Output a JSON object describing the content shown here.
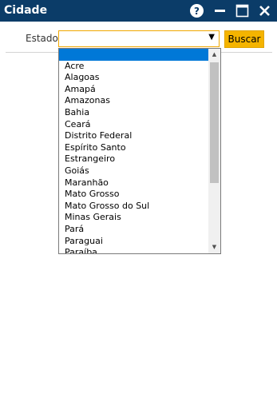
{
  "window": {
    "title": "Cidade",
    "help_icon": "help-icon",
    "minimize_icon": "minimize-icon",
    "maximize_icon": "maximize-icon",
    "close_icon": "close-icon"
  },
  "form": {
    "estado_label": "Estado:",
    "estado_value": "",
    "dropdown_arrow": "▼",
    "search_button_label": "Buscar"
  },
  "dropdown": {
    "options": [
      "",
      "Acre",
      "Alagoas",
      "Amapá",
      "Amazonas",
      "Bahia",
      "Ceará",
      "Distrito Federal",
      "Espírito Santo",
      "Estrangeiro",
      "Goiás",
      "Maranhão",
      "Mato Grosso",
      "Mato Grosso do Sul",
      "Minas Gerais",
      "Pará",
      "Paraguai",
      "Paraíba"
    ],
    "selected_index": 0,
    "scroll_up": "▲",
    "scroll_down": "▼"
  },
  "colors": {
    "titlebar": "#0b3c68",
    "accent": "#f5b400",
    "selection": "#0078d7"
  }
}
